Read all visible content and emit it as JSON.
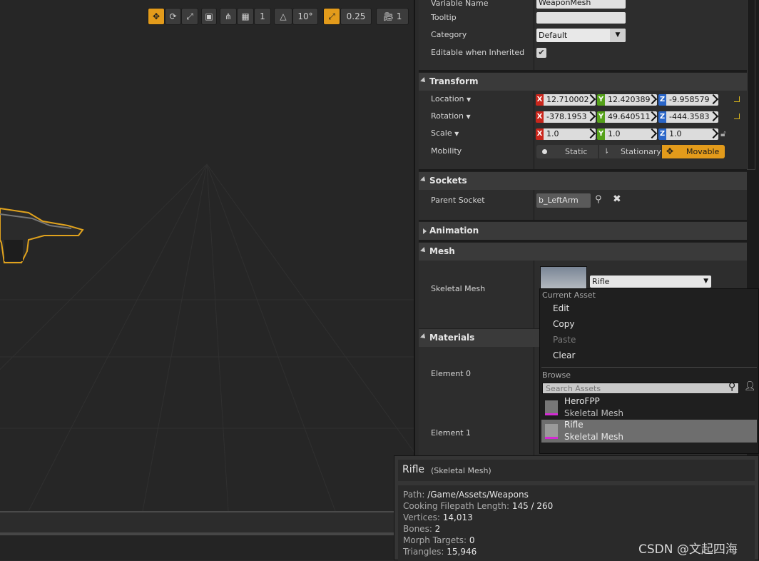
{
  "viewport": {
    "toolbar": {
      "snap_rotation": "10°",
      "snap_scale": "0.25",
      "camera_speed": "1",
      "grid_count": "1"
    }
  },
  "details": {
    "rows": {
      "variable_name": {
        "label": "Variable Name",
        "value": "WeaponMesh"
      },
      "tooltip": {
        "label": "Tooltip",
        "value": ""
      },
      "category": {
        "label": "Category",
        "value": "Default"
      },
      "editable_inherited": {
        "label": "Editable when Inherited",
        "checked": true
      }
    },
    "transform": {
      "title": "Transform",
      "location": {
        "label": "Location",
        "x": "12.710002",
        "y": "12.420389",
        "z": "-9.958579"
      },
      "rotation": {
        "label": "Rotation",
        "x": "-378.1953",
        "y": "49.640511",
        "z": "-444.3583"
      },
      "scale": {
        "label": "Scale",
        "x": "1.0",
        "y": "1.0",
        "z": "1.0"
      },
      "mobility": {
        "label": "Mobility",
        "options": [
          "Static",
          "Stationary",
          "Movable"
        ],
        "selected": "Movable"
      }
    },
    "sockets": {
      "title": "Sockets",
      "parent_socket": {
        "label": "Parent Socket",
        "value": "b_LeftArm"
      }
    },
    "animation": {
      "title": "Animation"
    },
    "mesh": {
      "title": "Mesh",
      "skeletal_mesh": {
        "label": "Skeletal Mesh",
        "value": "Rifle"
      }
    },
    "materials": {
      "title": "Materials",
      "element0": "Element 0",
      "element1": "Element 1"
    },
    "axis": {
      "x": "X",
      "y": "Y",
      "z": "Z"
    }
  },
  "popup": {
    "current_asset": "Current Asset",
    "items": [
      "Edit",
      "Copy",
      "Paste",
      "Clear"
    ],
    "browse": "Browse",
    "search_placeholder": "Search Assets",
    "assets": [
      {
        "name": "HeroFPP",
        "type": "Skeletal Mesh"
      },
      {
        "name": "Rifle",
        "type": "Skeletal Mesh"
      }
    ]
  },
  "tooltip": {
    "name": "Rifle",
    "type": "(Skeletal Mesh)",
    "lines": [
      {
        "k": "Path:",
        "v": "/Game/Assets/Weapons"
      },
      {
        "k": "Cooking Filepath Length:",
        "v": "145 / 260"
      },
      {
        "k": "Vertices:",
        "v": "14,013"
      },
      {
        "k": "Bones:",
        "v": "2"
      },
      {
        "k": "Morph Targets:",
        "v": "0"
      },
      {
        "k": "Triangles:",
        "v": "15,946"
      }
    ]
  },
  "watermark": "CSDN @文起四海",
  "colors": {
    "accent": "#e39b1b",
    "x_axis": "#c9261c",
    "y_axis": "#55a11a",
    "z_axis": "#2a66c9"
  }
}
